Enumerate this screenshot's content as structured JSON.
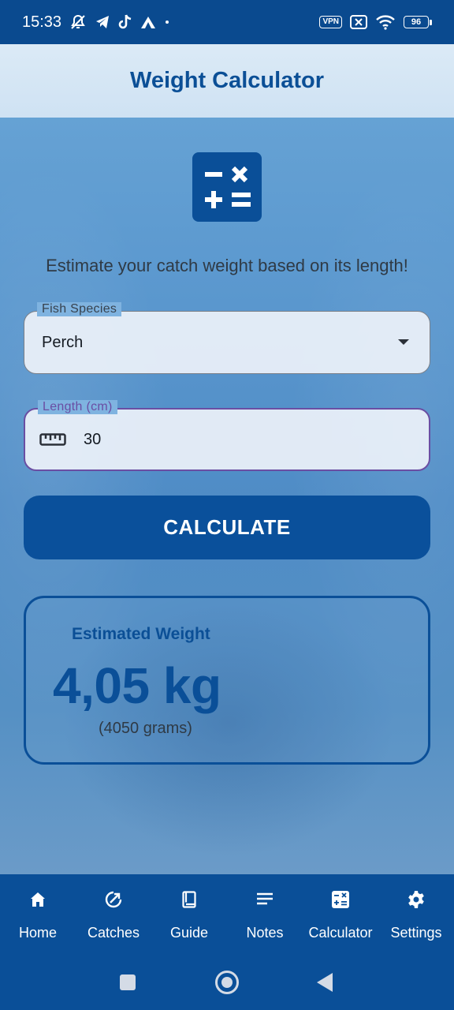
{
  "status_bar": {
    "time": "15:33",
    "vpn_label": "VPN",
    "battery_level": "96",
    "icons": [
      "mute-icon",
      "telegram-icon",
      "tiktok-icon",
      "app-icon",
      "dot-icon",
      "vpn-icon",
      "no-sim-icon",
      "wifi-icon",
      "battery-icon"
    ]
  },
  "app_bar": {
    "title": "Weight Calculator"
  },
  "main": {
    "logo_icon": "calculator-icon",
    "tagline": "Estimate your catch weight based on its length!",
    "species_field": {
      "label": "Fish Species",
      "value": "Perch",
      "icon": "dropdown-arrow-icon"
    },
    "length_field": {
      "label": "Length (cm)",
      "value": "30",
      "icon": "ruler-icon"
    },
    "calculate_button": "CALCULATE",
    "result": {
      "title": "Estimated Weight",
      "value": "4,05 kg",
      "grams": "(4050 grams)"
    }
  },
  "bottom_nav": {
    "items": [
      {
        "label": "Home",
        "icon": "home-icon"
      },
      {
        "label": "Catches",
        "icon": "catches-icon"
      },
      {
        "label": "Guide",
        "icon": "book-icon"
      },
      {
        "label": "Notes",
        "icon": "notes-icon"
      },
      {
        "label": "Calculator",
        "icon": "calculator-icon",
        "active": true
      },
      {
        "label": "Settings",
        "icon": "gear-icon"
      }
    ]
  },
  "colors": {
    "primary": "#0a4f98",
    "focus_border": "#6a4ea3",
    "app_bar_bg": "#d6e7f5",
    "text_dark": "#2f3a45"
  }
}
